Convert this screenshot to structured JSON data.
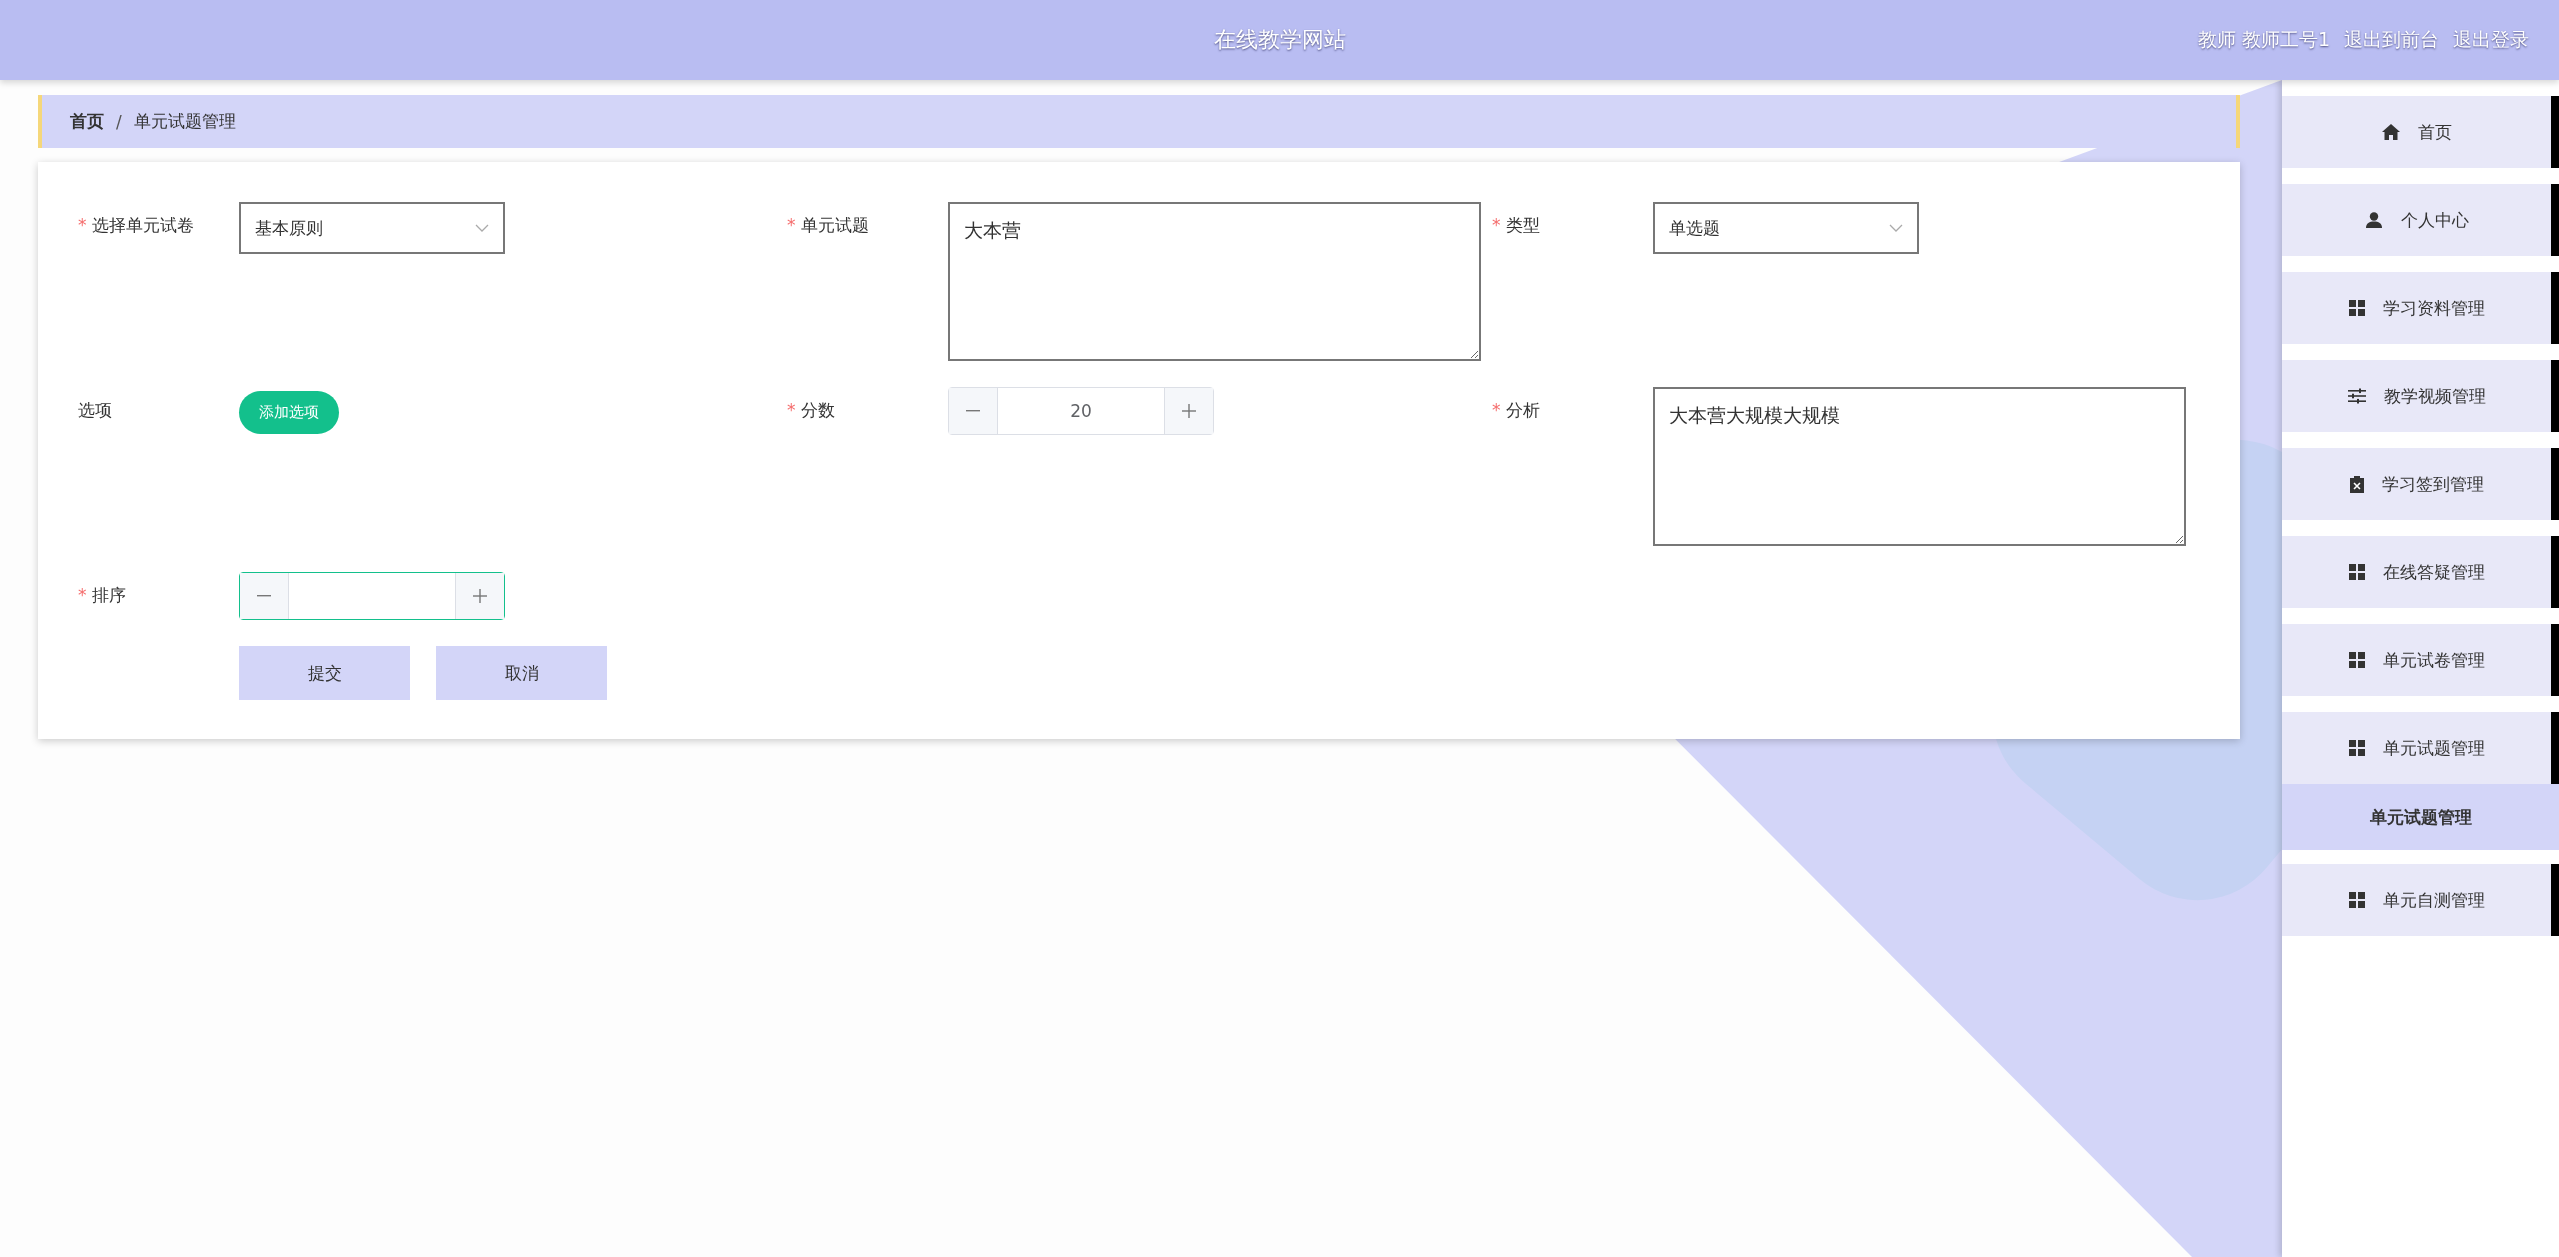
{
  "header": {
    "title": "在线教学网站",
    "user": "教师 教师工号1",
    "links": [
      "退出到前台",
      "退出登录"
    ]
  },
  "breadcrumb": {
    "items": [
      "首页",
      "单元试题管理"
    ],
    "separator": "/"
  },
  "form": {
    "required_mark": "*",
    "fields": [
      {
        "kind": "select",
        "label": "选择单元试卷",
        "required": true,
        "value": "基本原则"
      },
      {
        "kind": "textarea",
        "label": "单元试题",
        "required": true,
        "value": "大本营"
      },
      {
        "kind": "select",
        "label": "类型",
        "required": true,
        "value": "单选题"
      },
      {
        "kind": "options",
        "label": "选项",
        "required": false,
        "button": "添加选项"
      },
      {
        "kind": "number",
        "label": "分数",
        "required": true,
        "value": "20",
        "focused": false
      },
      {
        "kind": "textarea",
        "label": "分析",
        "required": true,
        "value": "大本营大规模大规模"
      },
      {
        "kind": "number",
        "label": "排序",
        "required": true,
        "focused": true
      }
    ],
    "buttons": [
      "提交",
      "取消"
    ]
  },
  "sidebar": {
    "items": [
      {
        "label": "首页"
      },
      {
        "label": "个人中心"
      },
      {
        "label": "学习资料管理"
      },
      {
        "label": "教学视频管理"
      },
      {
        "label": "学习签到管理"
      },
      {
        "label": "在线答疑管理"
      },
      {
        "label": "单元试卷管理"
      },
      {
        "label": "单元试题管理",
        "children": [
          {
            "label": "单元试题管理",
            "selected": true
          }
        ]
      },
      {
        "label": "单元自测管理"
      }
    ]
  }
}
